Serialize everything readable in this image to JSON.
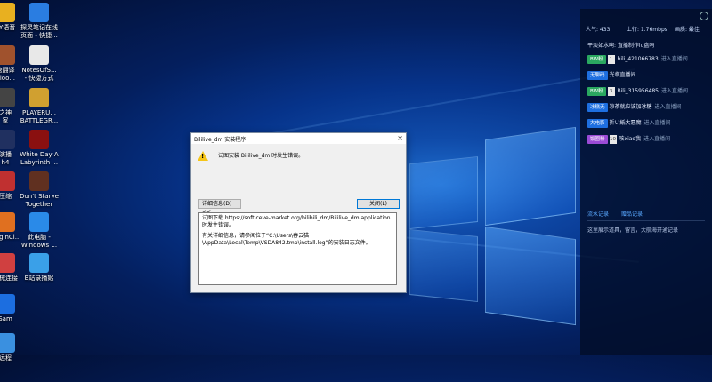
{
  "desktop_icons": [
    {
      "label": "YY语音",
      "color": "#e8b020"
    },
    {
      "label": "探灵笔记在线\n页面 - 快捷...",
      "color": "#2a7de1"
    },
    {
      "label": "速翻译\nBloo...",
      "color": "#a0522d"
    },
    {
      "label": "NotesOfS...\n- 快捷方式",
      "color": "#e8e8e8"
    },
    {
      "label": "之神\n家",
      "color": "#444444"
    },
    {
      "label": "PLAYERU...\nBATTLEGR...",
      "color": "#d0a030"
    },
    {
      "label": "演播\nh4",
      "color": "#203060"
    },
    {
      "label": "White Day A\nLabyrinth ...",
      "color": "#8a1010"
    },
    {
      "label": "压缩",
      "color": "#c03030"
    },
    {
      "label": "Don't Starve\nTogether",
      "color": "#603020"
    },
    {
      "label": "ologinCl...",
      "color": "#e07020"
    },
    {
      "label": "此电脑 -\nWindows ...",
      "color": "#2a8ae8"
    },
    {
      "label": "机械连接",
      "color": "#d04040"
    },
    {
      "label": "B站录播姬",
      "color": "#3aa0e8"
    },
    {
      "label": "Sam",
      "color": "#1c6ee0"
    },
    {
      "label": "远程",
      "color": "#3a90e0"
    }
  ],
  "dialog": {
    "title": "Bililive_dm 安装程序",
    "close_icon": "×",
    "warning_icon": "!",
    "message": "试图安装 Bililive_dm 时发生错误。",
    "details_button": "详细信息(D) <<",
    "close_button": "关闭(L)",
    "detail_line1": "试图下载 https://soft.ceve-market.org/bilibili_dm/Bililive_dm.application 时发生错误。",
    "detail_line2": "有关详细信息，请参阅位于“C:\\Users\\春云猫\\AppData\\Local\\Temp\\VSDA842.tmp\\install.log”的安装日志文件。"
  },
  "panel": {
    "popularity": "人气: 433",
    "upload": "上行: 1.76mbps",
    "quality": "画质: 最佳",
    "welcome": "平淡如水啊: 直播制作lu盘吗",
    "rows": [
      {
        "badge": "BW粉",
        "badge_color": "#2aa860",
        "level": "1",
        "name": "bili_421066783",
        "action": "进入直播间"
      },
      {
        "badge": "无聊码",
        "badge_color": "#1e6fe0",
        "level": "",
        "name": "光临直播间",
        "action": ""
      },
      {
        "badge": "BW粉",
        "badge_color": "#2aa860",
        "level": "3",
        "name": "Bili_315956485",
        "action": "进入直播间"
      },
      {
        "badge": "冰糕无",
        "badge_color": "#1e6fe0",
        "level": "",
        "name": "凉茶就应该加冰糖",
        "action": "进入直播间"
      },
      {
        "badge": "大电影",
        "badge_color": "#1e6fe0",
        "level": "",
        "name": "折い紙大悪魔",
        "action": "进入直播间"
      },
      {
        "badge": "饭圈粉",
        "badge_color": "#9b4bd6",
        "level": "10",
        "name": "咳xiao我",
        "action": "进入直播间"
      }
    ],
    "tab1": "流水记录",
    "tab2": "赠品记录",
    "notice": "这里展示道具，留言，大航海开通记录"
  }
}
